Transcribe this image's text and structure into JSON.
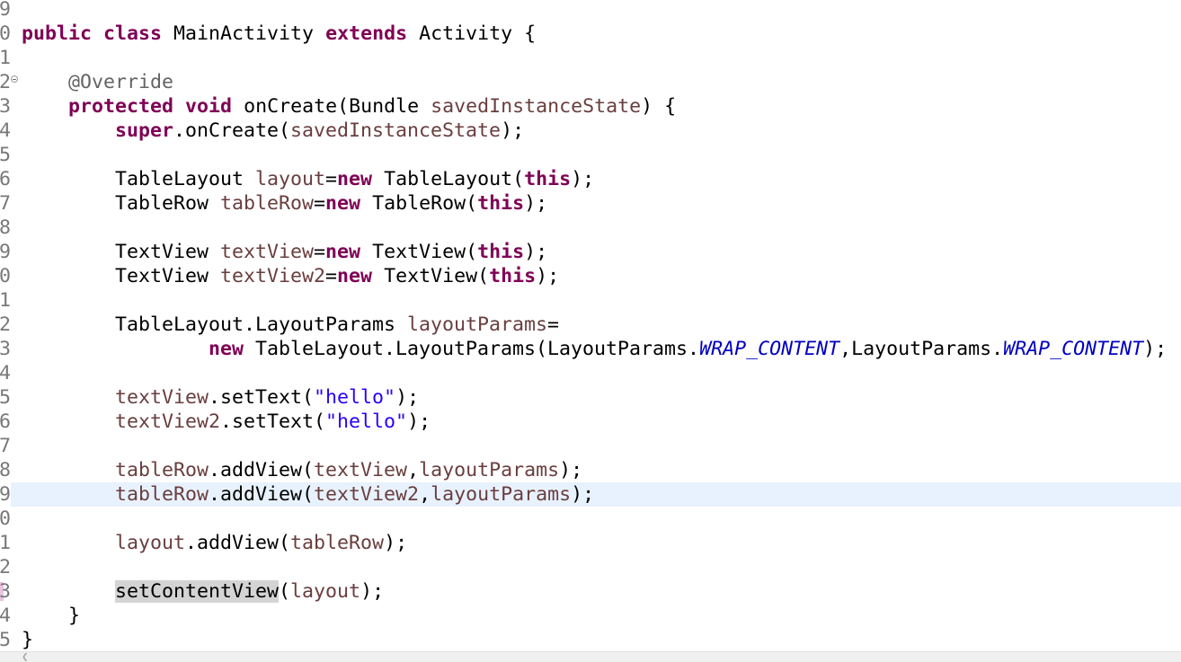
{
  "editor": {
    "language": "java",
    "current_line": "9",
    "lines": [
      {
        "n": "9",
        "text": ""
      },
      {
        "n": "0",
        "text": "public class MainActivity extends Activity {"
      },
      {
        "n": "1",
        "text": ""
      },
      {
        "n": "2",
        "text": "    @Override"
      },
      {
        "n": "3",
        "text": "    protected void onCreate(Bundle savedInstanceState) {"
      },
      {
        "n": "4",
        "text": "        super.onCreate(savedInstanceState);"
      },
      {
        "n": "5",
        "text": ""
      },
      {
        "n": "6",
        "text": "        TableLayout layout=new TableLayout(this);"
      },
      {
        "n": "7",
        "text": "        TableRow tableRow=new TableRow(this);"
      },
      {
        "n": "8",
        "text": ""
      },
      {
        "n": "9",
        "text": "        TextView textView=new TextView(this);"
      },
      {
        "n": "0",
        "text": "        TextView textView2=new TextView(this);"
      },
      {
        "n": "1",
        "text": ""
      },
      {
        "n": "2",
        "text": "        TableLayout.LayoutParams layoutParams="
      },
      {
        "n": "3",
        "text": "                new TableLayout.LayoutParams(LayoutParams.WRAP_CONTENT,LayoutParams.WRAP_CONTENT);"
      },
      {
        "n": "4",
        "text": ""
      },
      {
        "n": "5",
        "text": "        textView.setText(\"hello\");"
      },
      {
        "n": "6",
        "text": "        textView2.setText(\"hello\");"
      },
      {
        "n": "7",
        "text": ""
      },
      {
        "n": "8",
        "text": "        tableRow.addView(textView,layoutParams);"
      },
      {
        "n": "9",
        "text": "        tableRow.addView(textView2,layoutParams);"
      },
      {
        "n": "0",
        "text": ""
      },
      {
        "n": "1",
        "text": "        layout.addView(tableRow);"
      },
      {
        "n": "2",
        "text": ""
      },
      {
        "n": "3",
        "text": "        setContentView(layout);"
      },
      {
        "n": "4",
        "text": "    }"
      },
      {
        "n": "5",
        "text": "}"
      }
    ]
  },
  "colors": {
    "keyword": "#7f0055",
    "annotation": "#646464",
    "variable": "#6a3e3e",
    "string": "#2a00ff",
    "static_constant": "#0000c0",
    "current_line_highlight": "#e8f2fe",
    "occurrence_highlight": "#d4d4d4",
    "line_number": "#787878"
  },
  "icons": {
    "fold": "collapse-circle-icon",
    "scroll_left": "scroll-left-arrow-icon"
  }
}
